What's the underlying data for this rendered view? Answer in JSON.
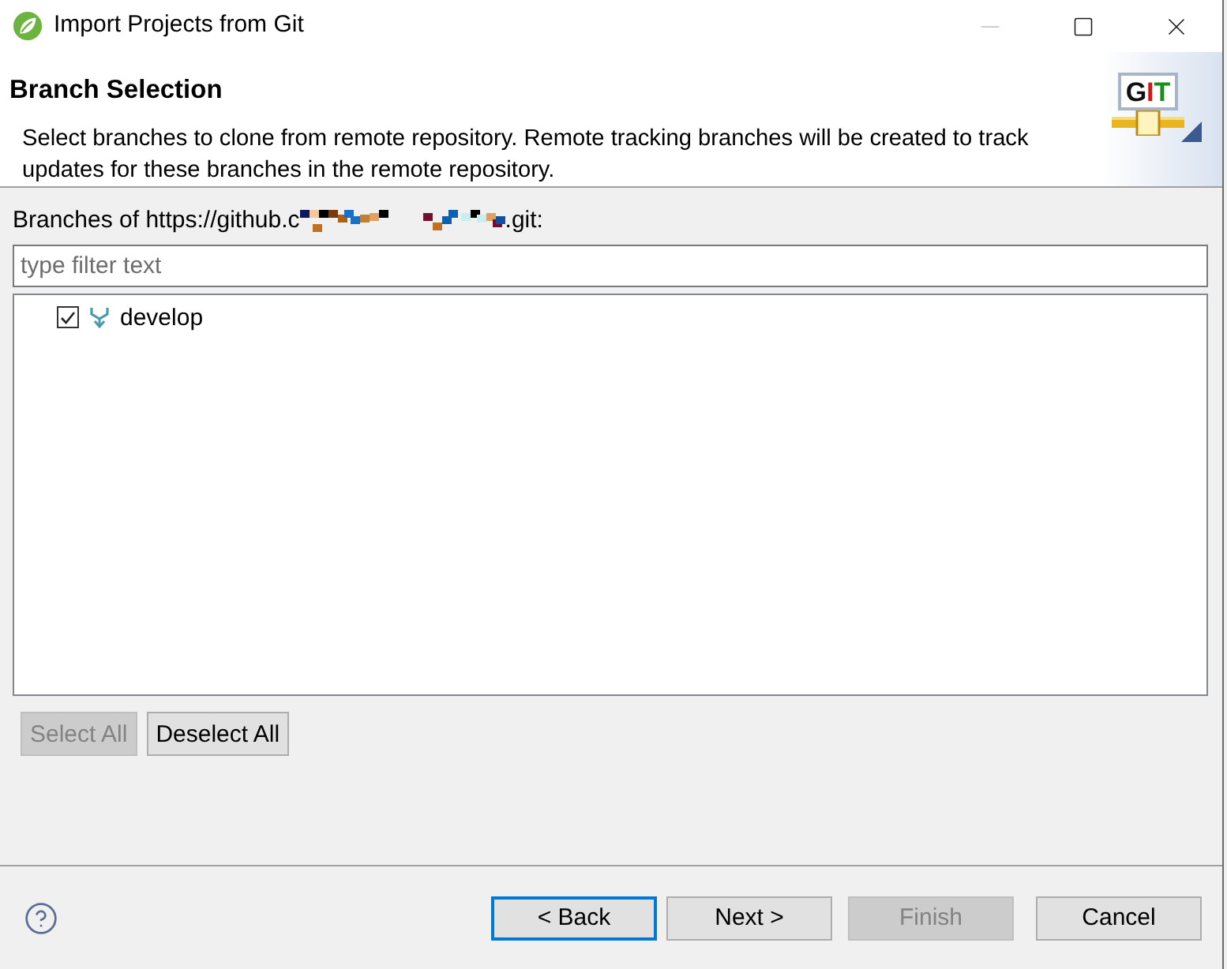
{
  "window": {
    "title": "Import Projects from Git",
    "controls": [
      {
        "kind": "minimize",
        "disabled": true
      },
      {
        "kind": "maximize",
        "disabled": false
      },
      {
        "kind": "close",
        "disabled": false
      }
    ]
  },
  "header": {
    "title": "Branch Selection",
    "description": "Select branches to clone from remote repository. Remote tracking branches will be created to track updates for these branches in the remote repository.",
    "logo_text": "GIT"
  },
  "branches": {
    "label_start": "Branches of https://github.c",
    "label_end": ".git:",
    "filter": {
      "placeholder": "type filter text"
    },
    "items": [
      {
        "name": "develop",
        "checked": true
      }
    ]
  },
  "selection_buttons": [
    {
      "label": "Select All",
      "disabled": true
    },
    {
      "label": "Deselect All",
      "disabled": false
    }
  ],
  "nav_buttons": [
    {
      "label": "< Back",
      "disabled": false,
      "focused": true
    },
    {
      "label": "Next >",
      "disabled": false,
      "focused": false
    },
    {
      "label": "Finish",
      "disabled": true,
      "focused": false
    },
    {
      "label": "Cancel",
      "disabled": false,
      "focused": false
    }
  ]
}
